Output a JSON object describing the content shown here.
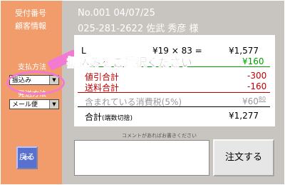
{
  "sidebar": {
    "order_number_label": "受付番号",
    "customer_info_label": "顧客情報",
    "payment_label": "支払方法",
    "payment_value": "振込み",
    "shipping_label": "発送方法",
    "shipping_value": "メール便",
    "back_label": "戻る"
  },
  "header": {
    "order_line": "No.001  04/07/25",
    "customer_line": "025-281-2622  佐武  秀彦 様"
  },
  "summary": {
    "item_code": "L",
    "item_calc": "¥19 ×   83 =",
    "item_total": "¥1,577",
    "fee_value": "¥160",
    "discount_label": "値引合計",
    "discount_value": "-300",
    "shipping_fee_label": "送料合計",
    "shipping_fee_value": "-160",
    "tax_label": "含まれている消費税(5%)",
    "tax_value": "¥60",
    "tax_fraction": "80",
    "total_label": "合計",
    "total_note": "(端数切捨)",
    "total_value": "¥1,277"
  },
  "overlay_message": "振込みをご選択ください",
  "comment": {
    "label": "コメントがあればお書きください",
    "value": ""
  },
  "order_button_label": "注文する",
  "colors": {
    "sidebar": "#f29c6b",
    "panel": "#c8c4c0",
    "highlight": "#f27ad2",
    "red": "#c00000",
    "green": "#009f00"
  }
}
